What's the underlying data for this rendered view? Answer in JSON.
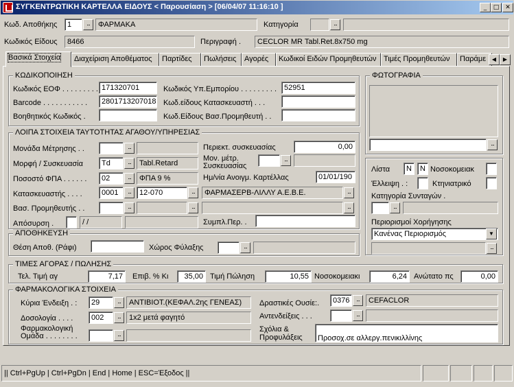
{
  "window": {
    "title": "ΣΥΓΚΕΝΤΡΩΤΙΚΗ ΚΑΡΤΕΛΛΑ ΕΙΔΟΥΣ < Παρουσίαση >   [06/04/07 11:16:10  ]",
    "btn_min": "_",
    "btn_max": "□",
    "btn_close": "✕"
  },
  "header": {
    "store_label": "Κωδ. Αποθήκης",
    "store_code": "1",
    "store_name": "ΦΑΡΜΑΚΑ",
    "category_label": "Κατηγορία",
    "category_code": "",
    "category_name": "",
    "item_code_label": "Κωδικός Είδους",
    "item_code": "8466",
    "desc_label": "Περιγραφή .",
    "desc_value": "CECLOR MR Tabl.Ret.8x750 mg"
  },
  "tabs": [
    "Βασικά Στοιχεία",
    "Διαχείριση Αποθέματος",
    "Παρτίδες",
    "Πωλήσεις",
    "Αγορές",
    "Κωδικοί Ειδών Προμηθευτών",
    "Τιμές Προμηθευτών",
    "Παράμε"
  ],
  "tab_scroll": {
    "left": "◀",
    "right": "▶"
  },
  "coding": {
    "title": "ΚΩΔΙΚΟΠΟΙΗΣΗ",
    "eof_label": "Κωδικός ΕΟΦ . . . . . . . . .",
    "eof": "171320701",
    "barcode_label": "Barcode . . . . . . . . . . .",
    "barcode": "2801713207018",
    "aux_label": "Βοηθητικός Κωδικός .",
    "aux": "",
    "sub_label": "Κωδικός Υπ.Εμπορίου . . . . . . . . .",
    "sub": "52951",
    "mfr_label": "Κωδ.είδους Κατασκευαστή . . .",
    "mfr": "",
    "sup_label": "Κωδ.Είδους Βασ.Προμηθευτή . .",
    "sup": ""
  },
  "other": {
    "title": "ΛΟΙΠΑ ΣΤΟΙΧΕΙΑ ΤΑΥΤΟΤΗΤΑΣ ΑΓΑΘΟΥ/ΥΠΗΡΕΣΙΑΣ",
    "unit_label": "Μονάδα Μέτρησης . .",
    "unit_code": "",
    "unit_name": "",
    "form_label": "Μορφή / Συσκευασία",
    "form_code": "Td",
    "form_name": "Tabl.Retard",
    "vat_label": "Ποσοστό ΦΠΑ . . . . . .",
    "vat_code": "02",
    "vat_name": "ΦΠΑ  9 %",
    "maker_label": "Κατασκευαστής . . . .",
    "maker_code": "0001",
    "maker_sub": "12-070",
    "maker_name": "ΦΑΡΜΑΣΕΡΒ-ΛΙΛΛΥ Α.Ε.Β.Ε.",
    "supplier_label": "Βασ. Προμηθευτής . .",
    "supplier_code": "",
    "withdraw_label": "Απόσυρση .",
    "withdraw_date": "/ /",
    "pack_label": "Περιεκτ. συσκευασίας",
    "pack_value": "0,00",
    "unitpack_label": "Μον. μέτρ. Συσκευασίας",
    "opendate_label": "Ημ/νία Ανοιγμ. Καρτέλλας",
    "opendate": "01/01/190",
    "extra_label": "Συμπλ.Περ. ."
  },
  "photo": {
    "title": "ΦΩΤΟΓΡΑΦΙΑ"
  },
  "flags": {
    "list_label": "Λίστα",
    "list_a": "N",
    "list_b": "N",
    "hosp_label": "Νοσοκομειακ",
    "short_label": "Έλλειψη . :",
    "vet_label": "Κτηνιατρικό",
    "recipe_cat_label": "Κατηγορία Συνταγών .",
    "restrict_label": "Περιορισμοί Χορήγησης",
    "restrict_value": "Κανένας Περιορισμός"
  },
  "storage": {
    "title": "ΑΠΟΘΗΚΕΥΣΗ",
    "shelf_label": "Θέση Αποθ. (Ράφι)",
    "shelf": "",
    "space_label": "Χώρος Φύλαξης"
  },
  "prices": {
    "title": "ΤΙΜΕΣ ΑΓΟΡΑΣ / ΠΩΛΗΣΗΣ",
    "buy_label": "Τελ. Τιμή αγ",
    "buy": "7,17",
    "markup_label": "Επιβ. % Κι",
    "markup": "35,00",
    "sell_label": "Τιμή Πώληση",
    "sell": "10,55",
    "hosp_label": "Νοσοκομειακι",
    "hosp": "6,24",
    "max_label": "Ανώτατο πς",
    "max": "0,00"
  },
  "pharma": {
    "title": "ΦΑΡΜΑΚΟΛΟΓΙΚΑ ΣΤΟΙΧΕΙΑ",
    "indication_label": "Κύρια Ένδειξη . :",
    "indication_code": "29",
    "indication_name": "ΑΝΤΙΒΙΟΤ.(ΚΕΦΑΛ.2ης ΓΕΝΕΑΣ)",
    "dosage_label": "Δοσολογία . . . .",
    "dosage_code": "002",
    "dosage_name": "1x2 μετά φαγητό",
    "group_label": "Φαρμακολογική Ομάδα . . . . . . . .",
    "active_label": "Δραστικές Ουσίε:.",
    "active_code": "0376",
    "active_name": "CEFACLOR",
    "contra_label": "Αντενδείξεις . . .",
    "notes_label": "Σχόλια & Προφυλάξεις",
    "notes": "Προσοχ.σε αλλεργ.πενικιλλίνης"
  },
  "status": {
    "text": "|| Ctrl+PgUp | Ctrl+PgDn | End | Home | ESC=Έξοδος ||"
  },
  "ui": {
    "lookup": "...",
    "dropdown": "▼"
  }
}
